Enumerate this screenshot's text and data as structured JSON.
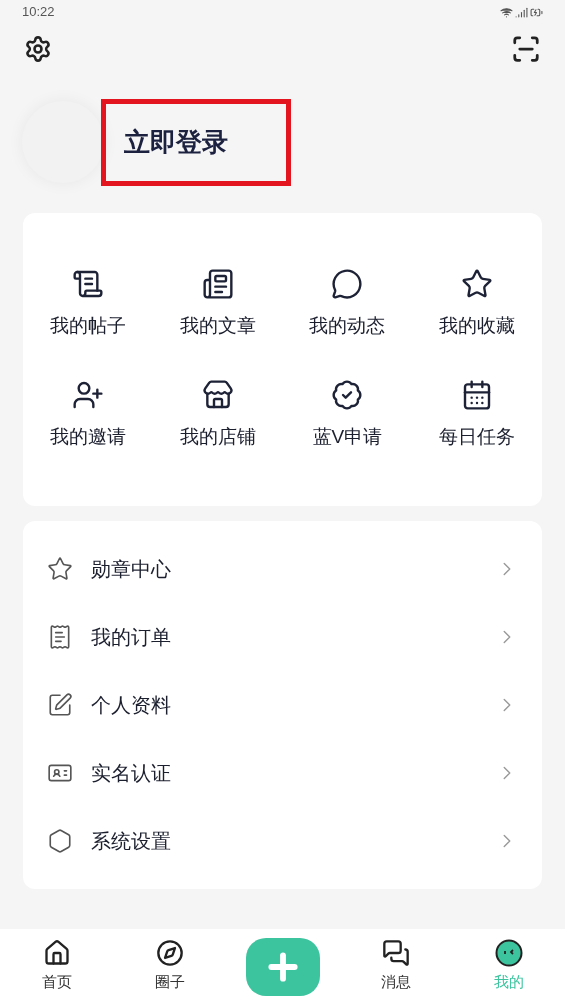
{
  "status_bar": {
    "time": "10:22"
  },
  "profile": {
    "login": "立即登录",
    "highlighted": true
  },
  "shortcuts": [
    {
      "label": "我的帖子"
    },
    {
      "label": "我的文章"
    },
    {
      "label": "我的动态"
    },
    {
      "label": "我的收藏"
    },
    {
      "label": "我的邀请"
    },
    {
      "label": "我的店铺"
    },
    {
      "label": "蓝V申请"
    },
    {
      "label": "每日任务"
    }
  ],
  "menu": [
    {
      "label": "勋章中心"
    },
    {
      "label": "我的订单"
    },
    {
      "label": "个人资料"
    },
    {
      "label": "实名认证"
    },
    {
      "label": "系统设置"
    }
  ],
  "tabs": [
    {
      "label": "首页",
      "selected": false
    },
    {
      "label": "圈子",
      "selected": false
    },
    {
      "kind": "add"
    },
    {
      "label": "消息",
      "selected": false
    },
    {
      "label": "我的",
      "selected": true
    }
  ]
}
